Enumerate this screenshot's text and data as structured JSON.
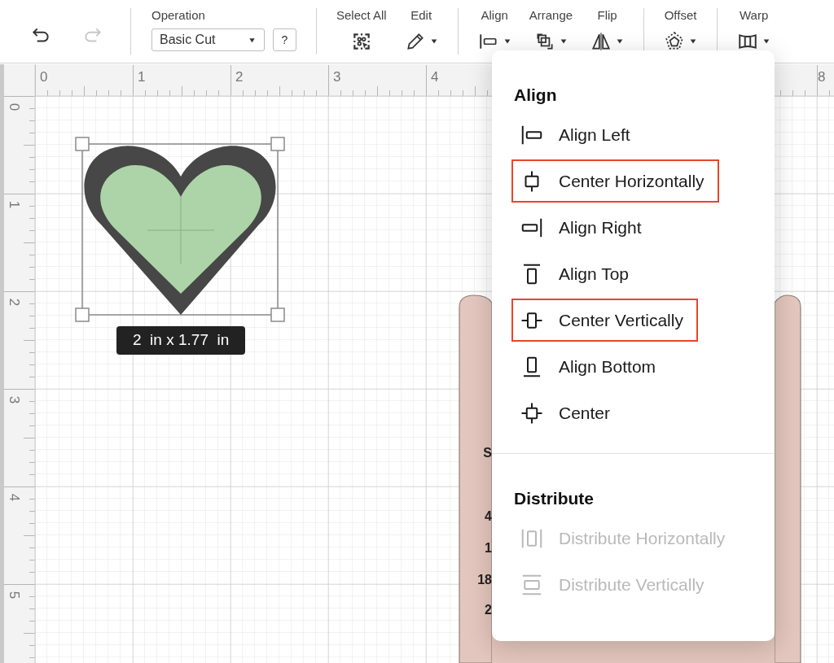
{
  "toolbar": {
    "undo": {
      "disabled": false
    },
    "redo": {
      "disabled": true
    },
    "operation": {
      "label": "Operation",
      "value": "Basic Cut",
      "help": "?"
    },
    "tool_groups": [
      [
        {
          "kind": "select_all",
          "label": "Select All",
          "has_menu": false
        },
        {
          "kind": "edit",
          "label": "Edit",
          "has_menu": true
        }
      ],
      [
        {
          "kind": "align",
          "label": "Align",
          "has_menu": true
        },
        {
          "kind": "arrange",
          "label": "Arrange",
          "has_menu": true
        },
        {
          "kind": "flip",
          "label": "Flip",
          "has_menu": true
        }
      ],
      [
        {
          "kind": "offset",
          "label": "Offset",
          "has_menu": true
        }
      ],
      [
        {
          "kind": "warp",
          "label": "Warp",
          "has_menu": true
        }
      ]
    ]
  },
  "top_ruler": {
    "labels": [
      "0",
      "1",
      "2",
      "3",
      "4"
    ],
    "far_label": "8"
  },
  "left_ruler": {
    "labels": [
      "0",
      "1",
      "2",
      "3",
      "4",
      "5"
    ]
  },
  "canvas": {
    "selection": {
      "size": "2  in x 1.77  in"
    },
    "mat_labels": [
      "S",
      "4",
      "1",
      "18",
      "2"
    ]
  },
  "align_menu": {
    "sections": [
      {
        "title": "Align",
        "items": [
          {
            "kind": "align_left",
            "label": "Align Left",
            "highlighted": false,
            "disabled": false
          },
          {
            "kind": "center_horizontal",
            "label": "Center Horizontally",
            "highlighted": true,
            "disabled": false
          },
          {
            "kind": "align_right",
            "label": "Align Right",
            "highlighted": false,
            "disabled": false
          },
          {
            "kind": "align_top",
            "label": "Align Top",
            "highlighted": false,
            "disabled": false
          },
          {
            "kind": "center_vertical",
            "label": "Center Vertically",
            "highlighted": true,
            "disabled": false
          },
          {
            "kind": "align_bottom",
            "label": "Align Bottom",
            "highlighted": false,
            "disabled": false
          },
          {
            "kind": "center",
            "label": "Center",
            "highlighted": false,
            "disabled": false
          }
        ]
      },
      {
        "title": "Distribute",
        "items": [
          {
            "kind": "distribute_horizontal",
            "label": "Distribute Horizontally",
            "highlighted": false,
            "disabled": true
          },
          {
            "kind": "distribute_vertical",
            "label": "Distribute Vertically",
            "highlighted": false,
            "disabled": true
          }
        ]
      }
    ]
  }
}
